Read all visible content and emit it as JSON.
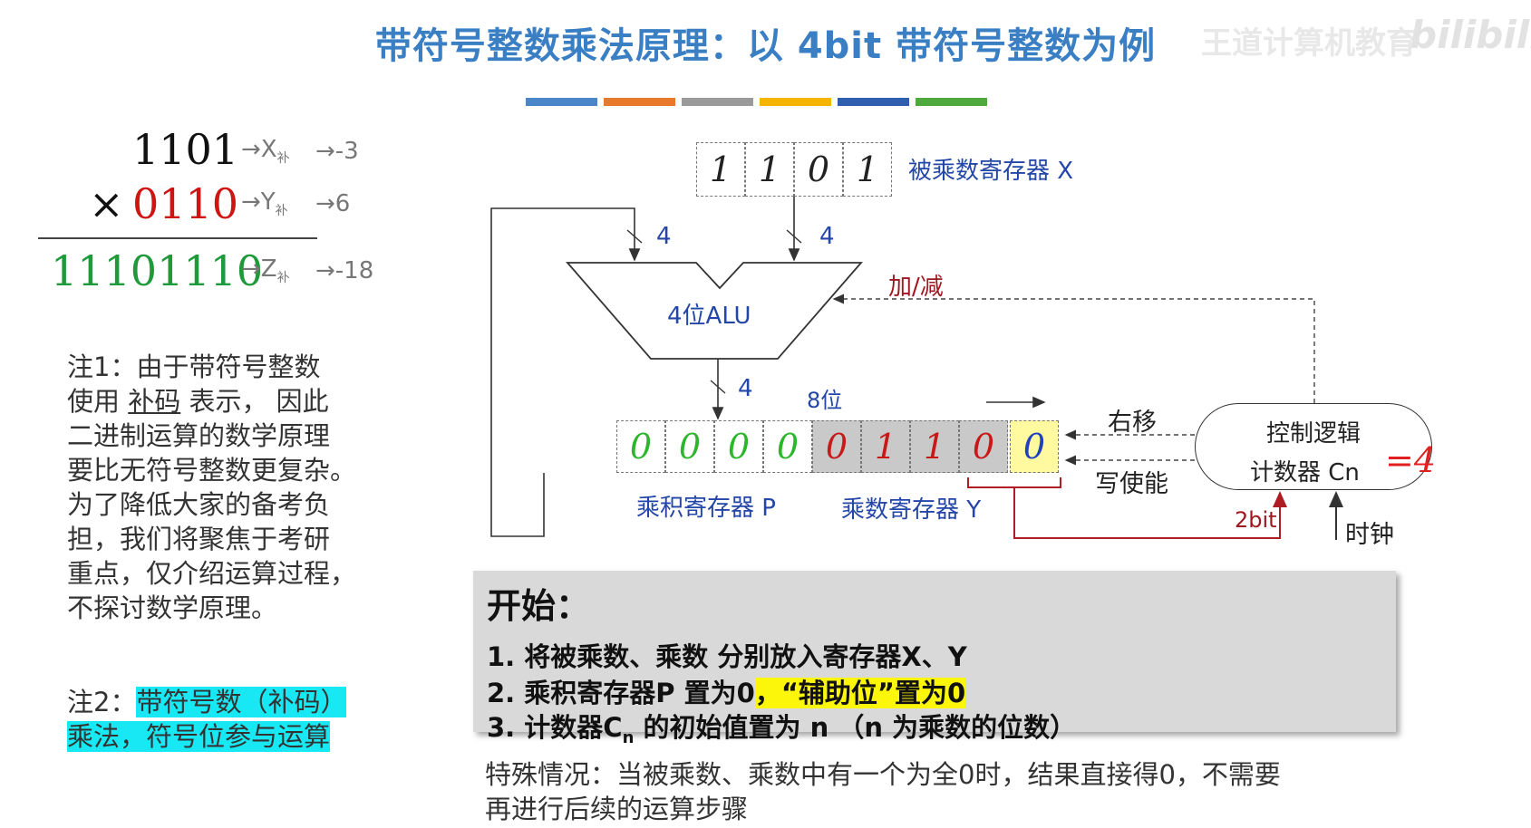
{
  "title": "带符号整数乘法原理：以 4bit 带符号整数为例",
  "watermark": "王道计算机教育",
  "logo": "bilibili",
  "color_bar": [
    "#4a86c8",
    "#e8782a",
    "#9a9a9a",
    "#f4b400",
    "#2f5eb0",
    "#4eaa3c"
  ],
  "calc": {
    "multiplicand": "1101",
    "multiplier_sign": "×",
    "multiplier": "0110",
    "product": "11101110",
    "x_arrow": "→X",
    "x_sub": "补",
    "x_value": "→-3",
    "y_arrow": "→Y",
    "y_sub": "补",
    "y_value": "→6",
    "z_arrow": "→Z",
    "z_sub": "补",
    "z_value": "→-18"
  },
  "note1": {
    "line1": "注1：由于带符号整数",
    "line2_a": "使用 ",
    "line2_b": "补码",
    "line2_c": " 表示， 因此",
    "line3": "二进制运算的数学原理",
    "line4": "要比无符号整数更复杂。",
    "line5": "为了降低大家的备考负",
    "line6": "担，我们将聚焦于考研",
    "line7": "重点，仅介绍运算过程，",
    "line8": "不探讨数学原理。"
  },
  "note2": {
    "prefix": "注2：",
    "hl1": "带符号数（补码）",
    "hl2": "乘法，符号位参与运算"
  },
  "diagram": {
    "x_register_bits": [
      "1",
      "1",
      "0",
      "1"
    ],
    "x_register_label": "被乘数寄存器 X",
    "bus_width_left": "4",
    "bus_width_right": "4",
    "bus_width_out": "4",
    "alu_label": "4位ALU",
    "add_sub_label": "加/减",
    "bits_8_label": "8位",
    "p_bits": [
      "0",
      "0",
      "0",
      "0"
    ],
    "y_bits": [
      "0",
      "1",
      "1",
      "0"
    ],
    "aux_bit": "0",
    "p_label": "乘积寄存器 P",
    "y_label": "乘数寄存器 Y",
    "shift_right_label": "右移",
    "write_enable_label": "写使能",
    "control_line1": "控制逻辑",
    "control_line2": "计数器 Cn",
    "counter_value": "=4",
    "two_bit_label": "2bit",
    "clock_label": "时钟"
  },
  "steps": {
    "heading": "开始：",
    "step1": "1. 将被乘数、乘数 分别放入寄存器X、Y",
    "step2_a": "2. 乘积寄存器P 置为0",
    "step2_b": "，“辅助位”置为0",
    "step3_a": "3. 计数器C",
    "step3_sub": "n",
    "step3_b": " 的初始值置为 n （n 为乘数的位数）"
  },
  "special": {
    "line1": "特殊情况：当被乘数、乘数中有一个为全0时，结果直接得0，不需要",
    "line2": "再进行后续的运算步骤"
  }
}
